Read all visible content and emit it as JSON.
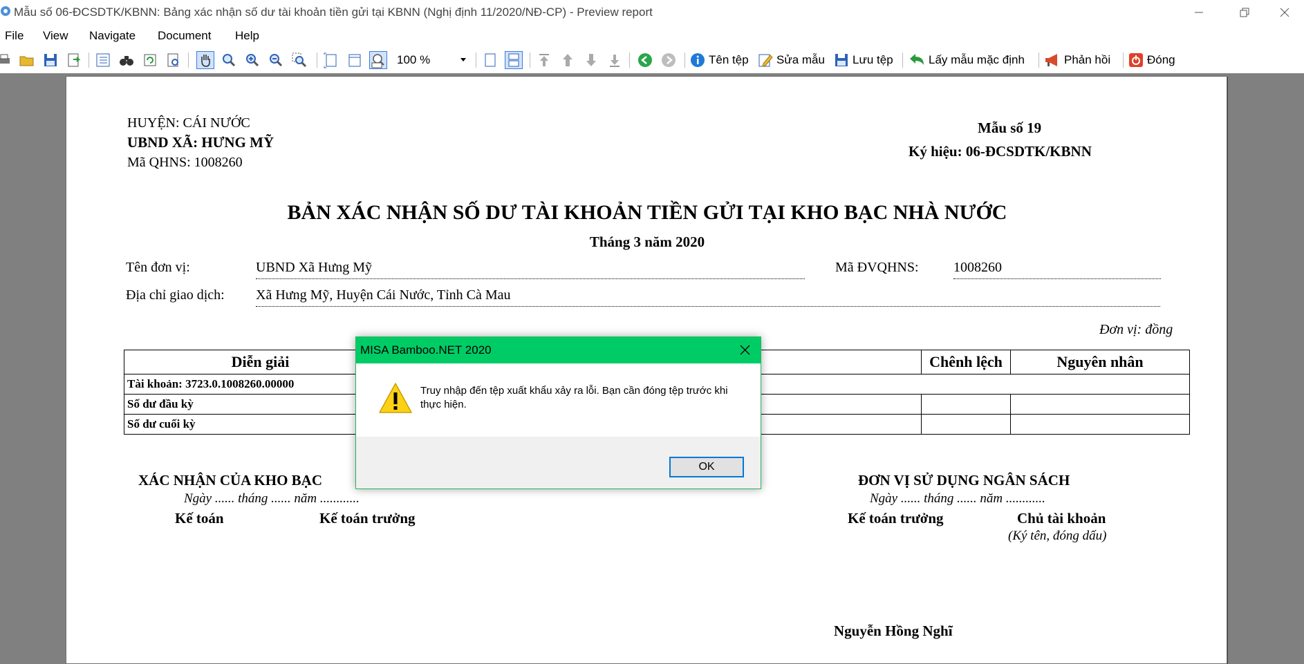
{
  "window": {
    "title": "Mẫu số 06-ĐCSDTK/KBNN: Bảng xác nhận số dư tài khoản tiền gửi tại KBNN (Nghị định 11/2020/NĐ-CP) - Preview report"
  },
  "menu": [
    "File",
    "View",
    "Navigate",
    "Document",
    "Help"
  ],
  "toolbar": {
    "zoom": "100 %",
    "ten_tep": "Tên tệp",
    "sua_mau": "Sửa mẫu",
    "luu_tep": "Lưu tệp",
    "lay_mau": "Lấy mẫu mặc định",
    "phan_hoi": "Phản hồi",
    "dong": "Đóng"
  },
  "report": {
    "huyen": "HUYỆN: CÁI NƯỚC",
    "ubnd": "UBND XÃ: HƯNG MỸ",
    "ma_qhns": "Mã QHNS: 1008260",
    "mau_so": "Mẫu số 19",
    "ky_hieu": "Ký hiệu: 06-ĐCSDTK/KBNN",
    "title": "BẢN XÁC NHẬN SỐ DƯ TÀI KHOẢN TIỀN GỬI TẠI KHO BẠC NHÀ NƯỚC",
    "period": "Tháng 3 năm 2020",
    "ten_don_vi_label": "Tên đơn vị:",
    "ten_don_vi": "UBND Xã Hưng Mỹ",
    "ma_dvqhns_label": "Mã ĐVQHNS:",
    "ma_dvqhns": "1008260",
    "dia_chi_label": "Địa chỉ giao dịch:",
    "dia_chi": "Xã Hưng Mỹ, Huyện Cái Nước, Tỉnh Cà Mau",
    "don_vi": "Đơn vị: đồng",
    "table": {
      "headers": [
        "Diễn giải",
        "",
        "Chênh lệch",
        "Nguyên nhân"
      ],
      "account_row": "Tài khoản: 3723.0.1008260.00000",
      "rows": [
        "Số dư đầu kỳ",
        "Số dư cuối kỳ"
      ]
    },
    "left_sign": {
      "heading": "XÁC NHẬN CỦA KHO BẠC",
      "date": "Ngày ...... tháng ...... năm ............",
      "role1": "Kế toán",
      "role2": "Kế toán trưởng"
    },
    "right_sign": {
      "heading": "ĐƠN VỊ SỬ DỤNG NGÂN SÁCH",
      "date": "Ngày ...... tháng ...... năm ............",
      "role1": "Kế toán trưởng",
      "role2": "Chủ tài khoản",
      "note": "(Ký tên, đóng dấu)",
      "signer": "Nguyễn Hồng Nghĩ"
    }
  },
  "dialog": {
    "title": "MISA Bamboo.NET 2020",
    "message": "Truy nhập đến tệp xuất khẩu xảy ra lỗi. Bạn cần đóng tệp trước khi thực hiện.",
    "ok": "OK"
  }
}
